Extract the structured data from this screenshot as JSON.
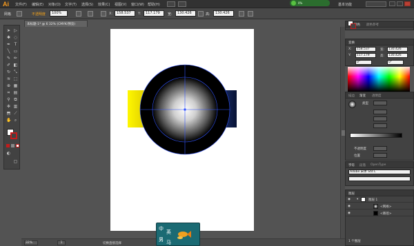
{
  "app": {
    "logo": "Ai",
    "menu": [
      "文件(F)",
      "编辑(E)",
      "对象(O)",
      "文字(T)",
      "选择(S)",
      "效果(C)",
      "视图(V)",
      "窗口(W)",
      "帮助(H)"
    ],
    "workspace": "基本功能",
    "notification": "0%"
  },
  "control_bar": {
    "selection_label": "网格",
    "opacity_label": "不透明度",
    "opacity_value": "100%",
    "x_value": "158.537",
    "y_value": "117.179",
    "w_value": "130.426",
    "h_value": "130.426"
  },
  "document": {
    "tab_title": "未标题-1* @ 6 32% (CMYK/预览)"
  },
  "status_bar": {
    "zoom": "32%",
    "page": "1",
    "text": "切换直接选择"
  },
  "popup": {
    "letters": [
      "中",
      "英",
      "男",
      "马"
    ]
  },
  "panels": {
    "color_guide": {
      "tabs": [
        "颜色",
        "颜色参考"
      ]
    },
    "transform": {
      "tabs": [
        "变换"
      ],
      "x": "158.537",
      "y": "117.179",
      "w": "130.426",
      "h": "130.426",
      "angle": "0°",
      "shear": "0°"
    },
    "gradient": {
      "tabs": [
        "描边",
        "渐变",
        "透明度"
      ],
      "type_label": "类型",
      "opacity_label": "不透明度",
      "location_label": "位置"
    },
    "character": {
      "tabs": [
        "字符",
        "段落",
        "OpenType"
      ],
      "font": "Adobe 宋体 Std L"
    },
    "layers": {
      "tabs": [
        "图层"
      ],
      "rows": [
        "图层 1",
        "<网格>",
        "<路径>"
      ],
      "footer": "1 个图层"
    }
  },
  "artwork": {
    "colors": {
      "black": "#000000",
      "yellow": "#ffe800",
      "navy": "#0a1a4a",
      "guide": "#3355ff"
    }
  }
}
